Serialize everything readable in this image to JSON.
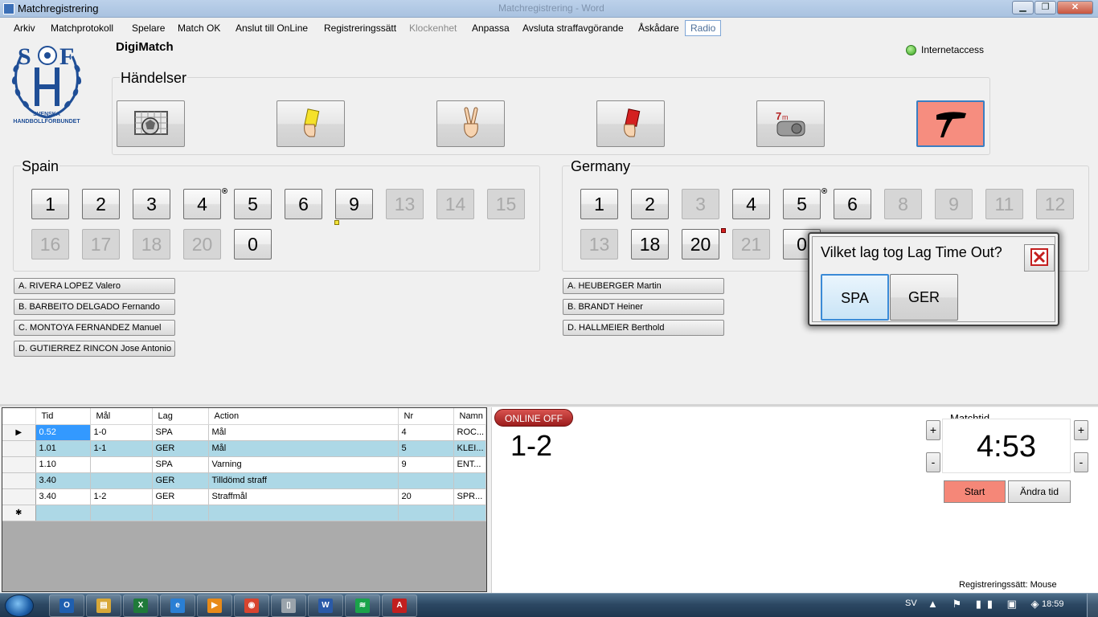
{
  "window": {
    "title": "Matchregistrering",
    "ghost_title": "Matchregistrering - Word",
    "min_glyph": "▁",
    "max_glyph": "❐",
    "close_glyph": "✕"
  },
  "menu": [
    "Arkiv",
    "Matchprotokoll",
    "Spelare",
    "Match OK",
    "Anslut till OnLine",
    "Registreringssätt",
    "Klockenhet",
    "Anpassa",
    "Avsluta straffavgörande",
    "Åskådare",
    "Radio"
  ],
  "header": {
    "app_name": "DigiMatch",
    "logo_text_1": "SVENSKA",
    "logo_text_2": "HANDBOLLFÖRBUNDET",
    "internet_label": "Internetaccess"
  },
  "events": {
    "title": "Händelser",
    "buttons": [
      "goal-icon",
      "yellow-card-icon",
      "two-minutes-icon",
      "red-card-icon",
      "penalty-7m-icon",
      "timeout-icon"
    ]
  },
  "teams": {
    "home": {
      "name": "Spain",
      "row1": [
        {
          "nr": "1",
          "disabled": false
        },
        {
          "nr": "2",
          "disabled": false
        },
        {
          "nr": "3",
          "disabled": false
        },
        {
          "nr": "4",
          "disabled": false
        },
        {
          "nr": "5",
          "disabled": false
        },
        {
          "nr": "6",
          "disabled": false
        },
        {
          "nr": "9",
          "disabled": false
        },
        {
          "nr": "13",
          "disabled": true
        },
        {
          "nr": "14",
          "disabled": true
        },
        {
          "nr": "15",
          "disabled": true
        }
      ],
      "row2": [
        {
          "nr": "16",
          "disabled": true
        },
        {
          "nr": "17",
          "disabled": true
        },
        {
          "nr": "18",
          "disabled": true
        },
        {
          "nr": "20",
          "disabled": true
        },
        {
          "nr": "0",
          "disabled": false
        }
      ],
      "officials": [
        "A. RIVERA LOPEZ Valero",
        "B. BARBEITO DELGADO Fernando",
        "C. MONTOYA FERNANDEZ Manuel",
        "D. GUTIERREZ RINCON Jose Antonio"
      ]
    },
    "away": {
      "name": "Germany",
      "row1": [
        {
          "nr": "1",
          "disabled": false
        },
        {
          "nr": "2",
          "disabled": false
        },
        {
          "nr": "3",
          "disabled": true
        },
        {
          "nr": "4",
          "disabled": false
        },
        {
          "nr": "5",
          "disabled": false
        },
        {
          "nr": "6",
          "disabled": false
        },
        {
          "nr": "8",
          "disabled": true
        },
        {
          "nr": "9",
          "disabled": true
        },
        {
          "nr": "11",
          "disabled": true
        },
        {
          "nr": "12",
          "disabled": true
        }
      ],
      "row2": [
        {
          "nr": "13",
          "disabled": true
        },
        {
          "nr": "18",
          "disabled": false
        },
        {
          "nr": "20",
          "disabled": false
        },
        {
          "nr": "21",
          "disabled": true
        },
        {
          "nr": "0",
          "disabled": false
        }
      ],
      "officials": [
        "A. HEUBERGER Martin",
        "B. BRANDT Heiner",
        "D. HALLMEIER Berthold"
      ]
    }
  },
  "dialog": {
    "question": "Vilket lag tog Lag Time Out?",
    "btn_spa": "SPA",
    "btn_ger": "GER"
  },
  "log": {
    "columns": [
      "Tid",
      "Mål",
      "Lag",
      "Action",
      "Nr",
      "Namn"
    ],
    "current_row_marker": "▶",
    "new_row_marker": "✱",
    "rows": [
      [
        "0.52",
        "1-0",
        "SPA",
        "Mål",
        "4",
        "ROC..."
      ],
      [
        "1.01",
        "1-1",
        "GER",
        "Mål",
        "5",
        "KLEI..."
      ],
      [
        "1.10",
        "",
        "SPA",
        "Varning",
        "9",
        "ENT..."
      ],
      [
        "3.40",
        "",
        "GER",
        "Tilldömd straff",
        "",
        ""
      ],
      [
        "3.40",
        "1-2",
        "GER",
        "Straffmål",
        "20",
        "SPR..."
      ]
    ]
  },
  "match": {
    "online_status": "ONLINE OFF",
    "score": "1-2",
    "matchtid_label": "Matchtid",
    "clock": "4:53",
    "plus": "+",
    "minus": "-",
    "start_label": "Start",
    "change_time_label": "Ändra tid",
    "reg_mode": "Registreringssätt: Mouse"
  },
  "taskbar": {
    "lang": "SV",
    "tray": "▲ ⚑ ▮▮ ▣ ◈",
    "time": "18:59",
    "apps": [
      "outlook-icon",
      "explorer-icon",
      "excel-icon",
      "ie-icon",
      "media-icon",
      "chrome-icon",
      "app-icon",
      "word-icon",
      "spotify-icon",
      "pdf-icon"
    ],
    "app_glyphs": [
      "O",
      "▤",
      "X",
      "e",
      "▶",
      "◉",
      "▯",
      "W",
      "≋",
      "A"
    ]
  },
  "colors": {
    "event_active": "#f68d7f",
    "start_button": "#f58778",
    "row_alt": "#add8e6",
    "online_off": "#b22222"
  }
}
